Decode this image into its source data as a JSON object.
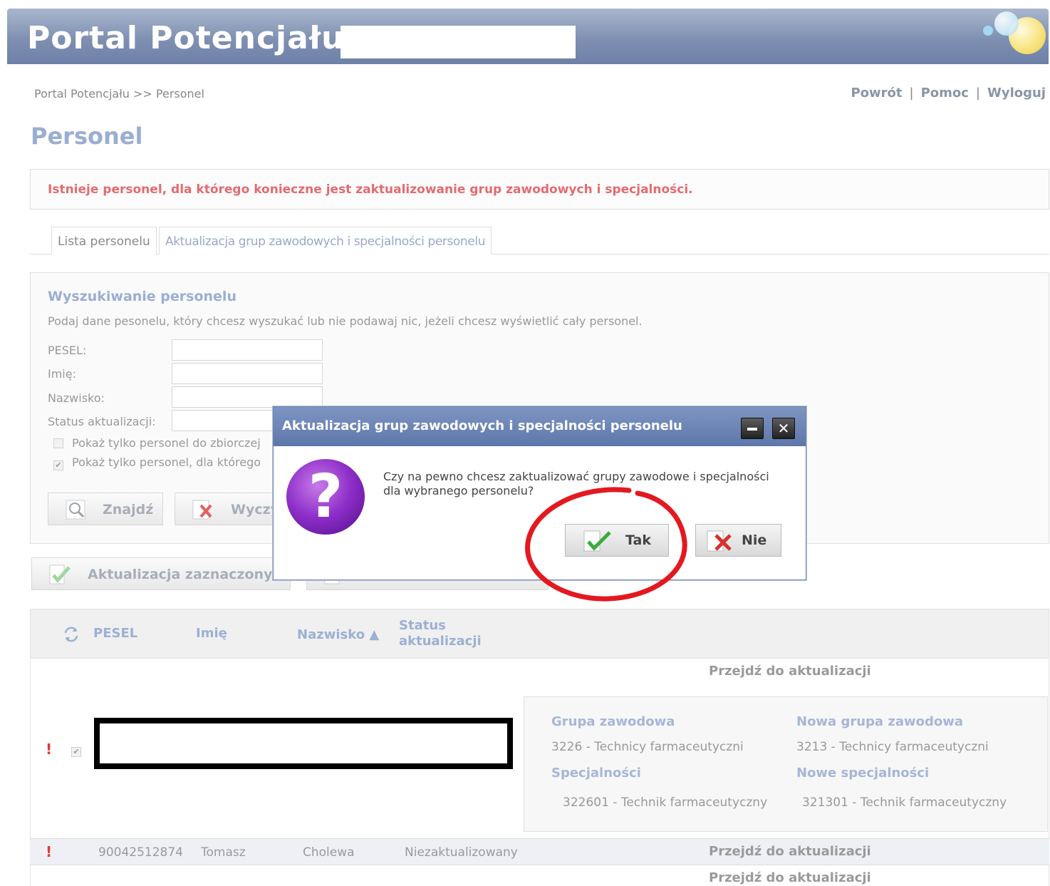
{
  "header": {
    "title": "Portal Potencjału"
  },
  "breadcrumb": "Portal Potencjału >> Personel",
  "top_links": {
    "back": "Powrót",
    "help": "Pomoc",
    "logout": "Wyloguj",
    "separator": "|"
  },
  "page_title": "Personel",
  "alert": "Istnieje personel, dla którego konieczne jest zaktualizowanie grup zawodowych i specjalności.",
  "tabs": [
    {
      "label": "Lista personelu"
    },
    {
      "label": "Aktualizacja grup zawodowych i specjalności personelu"
    }
  ],
  "search": {
    "title": "Wyszukiwanie personelu",
    "description": "Podaj dane pesonelu, który chcesz wyszukać lub nie podawaj nic, jeżeli chcesz wyświetlić cały personel.",
    "fields": [
      {
        "label": "PESEL:",
        "value": ""
      },
      {
        "label": "Imię:",
        "value": ""
      },
      {
        "label": "Nazwisko:",
        "value": ""
      },
      {
        "label": "Status aktualizacji:",
        "value": ""
      }
    ],
    "checks": [
      {
        "label": "Pokaż tylko personel do zbiorczej",
        "checked": false
      },
      {
        "label": "Pokaż tylko personel, dla którego",
        "checked": true
      }
    ],
    "find_button": "Znajdź",
    "clear_button": "Wyczyś"
  },
  "actions": {
    "update_selected": "Aktualizacja zaznaczonych"
  },
  "table": {
    "headers": {
      "pesel": "PESEL",
      "first_name": "Imię",
      "last_name": "Nazwisko ▲",
      "status_line1": "Status",
      "status_line2": "aktualizacji"
    },
    "goto_label": "Przejdź do aktualizacji",
    "row_marker": "!",
    "expanded_detail": {
      "group_label": "Grupa zawodowa",
      "group_value": "3226 - Technicy farmaceutyczni",
      "new_group_label": "Nowa grupa zawodowa",
      "new_group_value": "3213 - Technicy farmaceutyczni",
      "spec_label": "Specjalności",
      "spec_value": "322601 - Technik farmaceutyczny",
      "new_spec_label": "Nowe specjalności",
      "new_spec_value": "321301 - Technik farmaceutyczny"
    },
    "rows": [
      {
        "pesel": "90042512874",
        "first_name": "Tomasz",
        "last_name": "Cholewa",
        "status": "Niezaktualizowany"
      }
    ]
  },
  "dialog": {
    "title": "Aktualizacja grup zawodowych i specjalności personelu",
    "message_line1": "Czy na pewno chcesz zaktualizować grupy zawodowe i specjalności",
    "message_line2": "dla wybranego personelu?",
    "yes": "Tak",
    "no": "Nie",
    "question_mark": "?"
  },
  "colors": {
    "header": "#7f90b2",
    "accent": "#9aaed3",
    "alert": "#e36b6f",
    "annotation": "#e3191f"
  }
}
